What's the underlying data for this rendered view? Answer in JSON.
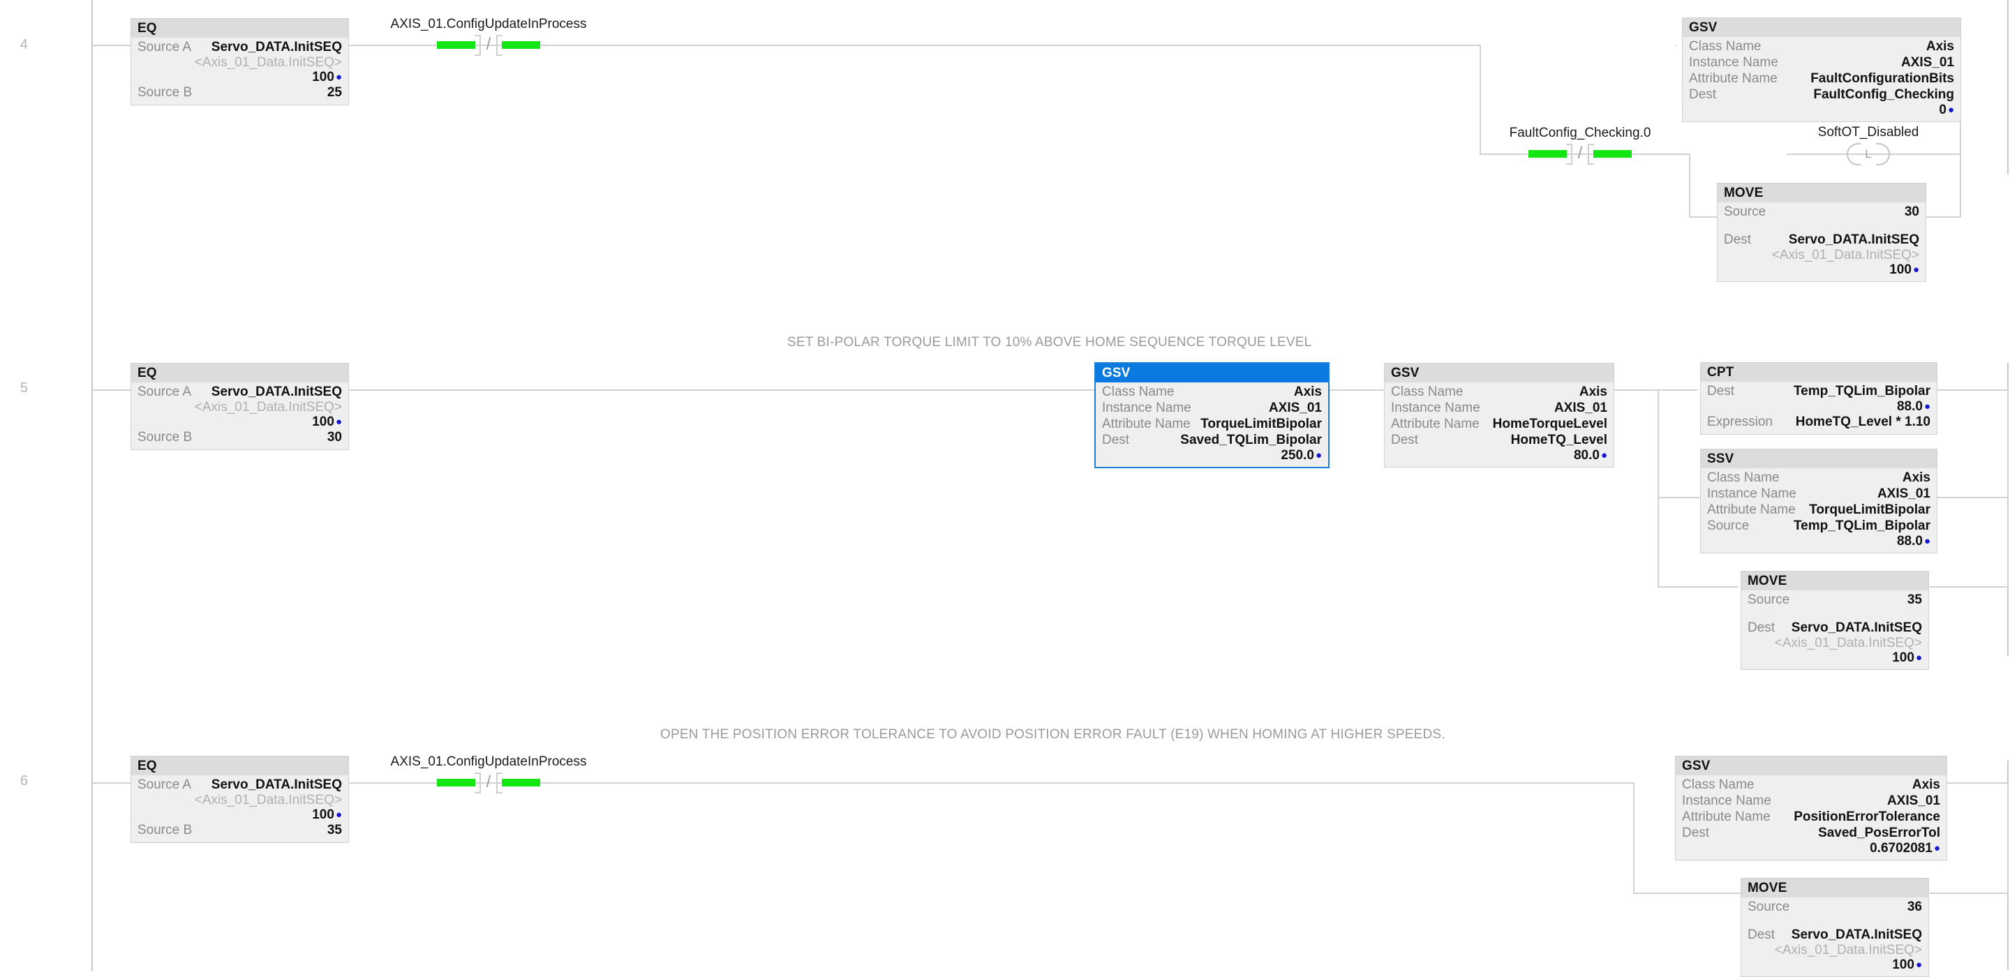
{
  "editor": {
    "app": "ladder-logic-routine",
    "accent_selected": "#0a7ae0",
    "contact_energized_color": "#14e614",
    "rail_color": "#c8c8c8"
  },
  "rungs": [
    {
      "number": "4",
      "comment": "",
      "elements": {
        "eq": {
          "title": "EQ",
          "source_a_label": "Source A",
          "source_a_value": "Servo_DATA.InitSEQ",
          "source_a_alias": "<Axis_01_Data.InitSEQ>",
          "source_a_number": "100",
          "source_b_label": "Source B",
          "source_b_value": "25"
        },
        "contact": {
          "name": "AXIS_01.ConfigUpdateInProcess",
          "type": "examine-if-open",
          "state": "energized"
        },
        "gsv": {
          "title": "GSV",
          "class_name_label": "Class Name",
          "class_name_value": "Axis",
          "instance_name_label": "Instance Name",
          "instance_name_value": "AXIS_01",
          "attribute_name_label": "Attribute Name",
          "attribute_name_value": "FaultConfigurationBits",
          "dest_label": "Dest",
          "dest_value": "FaultConfig_Checking",
          "dest_number": "0"
        },
        "branch_contact": {
          "name": "FaultConfig_Checking.0",
          "type": "examine-if-open",
          "state": "energized"
        },
        "coil": {
          "name": "SoftOT_Disabled",
          "mark": "L",
          "type": "latch-coil"
        },
        "move": {
          "title": "MOVE",
          "source_label": "Source",
          "source_value": "30",
          "dest_label": "Dest",
          "dest_value": "Servo_DATA.InitSEQ",
          "dest_alias": "<Axis_01_Data.InitSEQ>",
          "dest_number": "100"
        }
      }
    },
    {
      "number": "5",
      "comment": "SET BI-POLAR TORQUE LIMIT TO 10% ABOVE HOME SEQUENCE TORQUE LEVEL",
      "elements": {
        "eq": {
          "title": "EQ",
          "source_a_label": "Source A",
          "source_a_value": "Servo_DATA.InitSEQ",
          "source_a_alias": "<Axis_01_Data.InitSEQ>",
          "source_a_number": "100",
          "source_b_label": "Source B",
          "source_b_value": "30"
        },
        "gsv_selected": {
          "title": "GSV",
          "selected": true,
          "class_name_label": "Class Name",
          "class_name_value": "Axis",
          "instance_name_label": "Instance Name",
          "instance_name_value": "AXIS_01",
          "attribute_name_label": "Attribute Name",
          "attribute_name_value": "TorqueLimitBipolar",
          "dest_label": "Dest",
          "dest_value": "Saved_TQLim_Bipolar",
          "dest_number": "250.0"
        },
        "gsv2": {
          "title": "GSV",
          "class_name_label": "Class Name",
          "class_name_value": "Axis",
          "instance_name_label": "Instance Name",
          "instance_name_value": "AXIS_01",
          "attribute_name_label": "Attribute Name",
          "attribute_name_value": "HomeTorqueLevel",
          "dest_label": "Dest",
          "dest_value": "HomeTQ_Level",
          "dest_number": "80.0"
        },
        "cpt": {
          "title": "CPT",
          "dest_label": "Dest",
          "dest_value": "Temp_TQLim_Bipolar",
          "dest_number": "88.0",
          "expression_label": "Expression",
          "expression_value": "HomeTQ_Level * 1.10"
        },
        "ssv": {
          "title": "SSV",
          "class_name_label": "Class Name",
          "class_name_value": "Axis",
          "instance_name_label": "Instance Name",
          "instance_name_value": "AXIS_01",
          "attribute_name_label": "Attribute Name",
          "attribute_name_value": "TorqueLimitBipolar",
          "source_label": "Source",
          "source_value": "Temp_TQLim_Bipolar",
          "source_number": "88.0"
        },
        "move": {
          "title": "MOVE",
          "source_label": "Source",
          "source_value": "35",
          "dest_label": "Dest",
          "dest_value": "Servo_DATA.InitSEQ",
          "dest_alias": "<Axis_01_Data.InitSEQ>",
          "dest_number": "100"
        }
      }
    },
    {
      "number": "6",
      "comment": "OPEN THE POSITION ERROR TOLERANCE TO AVOID POSITION ERROR FAULT (E19) WHEN HOMING AT HIGHER SPEEDS.",
      "elements": {
        "eq": {
          "title": "EQ",
          "source_a_label": "Source A",
          "source_a_value": "Servo_DATA.InitSEQ",
          "source_a_alias": "<Axis_01_Data.InitSEQ>",
          "source_a_number": "100",
          "source_b_label": "Source B",
          "source_b_value": "35"
        },
        "contact": {
          "name": "AXIS_01.ConfigUpdateInProcess",
          "type": "examine-if-open",
          "state": "energized"
        },
        "gsv": {
          "title": "GSV",
          "class_name_label": "Class Name",
          "class_name_value": "Axis",
          "instance_name_label": "Instance Name",
          "instance_name_value": "AXIS_01",
          "attribute_name_label": "Attribute Name",
          "attribute_name_value": "PositionErrorTolerance",
          "dest_label": "Dest",
          "dest_value": "Saved_PosErrorTol",
          "dest_number": "0.6702081"
        },
        "move": {
          "title": "MOVE",
          "source_label": "Source",
          "source_value": "36",
          "dest_label": "Dest",
          "dest_value": "Servo_DATA.InitSEQ",
          "dest_alias": "<Axis_01_Data.InitSEQ>",
          "dest_number": "100"
        }
      }
    }
  ]
}
